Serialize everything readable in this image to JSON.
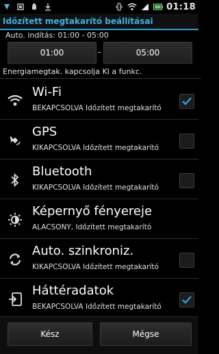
{
  "status_bar": {
    "time": "01:18",
    "icons_left": [
      "sync-icon",
      "battery-saver-icon",
      "android-icon",
      "download-icon"
    ],
    "icons_right": [
      "vibrate-icon",
      "wifi-icon",
      "signal-icon",
      "battery-icon"
    ]
  },
  "title": "Időzített megtakarító beállításai",
  "auto_start": "Auto. indítás: 01:00 - 05:00",
  "time_from": "01:00",
  "time_separator": "-",
  "time_to": "05:00",
  "section_label": "Energiamegtak. kapcsolja KI a funkc.",
  "items": [
    {
      "title": "Wi-Fi",
      "subtitle": "BEKAPCSOLVA Időzített megtakarító",
      "checked": true,
      "icon": "wifi-icon"
    },
    {
      "title": "GPS",
      "subtitle": "KIKAPCSOLVA Időzített megtakarító",
      "checked": false,
      "icon": "gps-icon"
    },
    {
      "title": "Bluetooth",
      "subtitle": "KIKAPCSOLVA Időzített megtakarító",
      "checked": false,
      "icon": "bluetooth-icon"
    },
    {
      "title": "Képernyő fényereje",
      "subtitle": "ALACSONY, Időzített megtakarító",
      "checked": null,
      "icon": "brightness-icon"
    },
    {
      "title": "Auto. szinkroniz.",
      "subtitle": "KIKAPCSOLVA Időzített megtakarító",
      "checked": false,
      "icon": "sync-icon"
    },
    {
      "title": "Háttéradatok",
      "subtitle": "BEKAPCSOLVA Időzített megtakarító",
      "checked": true,
      "icon": "background-data-icon"
    }
  ],
  "buttons": {
    "done": "Kész",
    "cancel": "Mégse"
  },
  "colors": {
    "accent": "#3cb4ec",
    "check": "#2aa0e0",
    "background": "#000000"
  }
}
